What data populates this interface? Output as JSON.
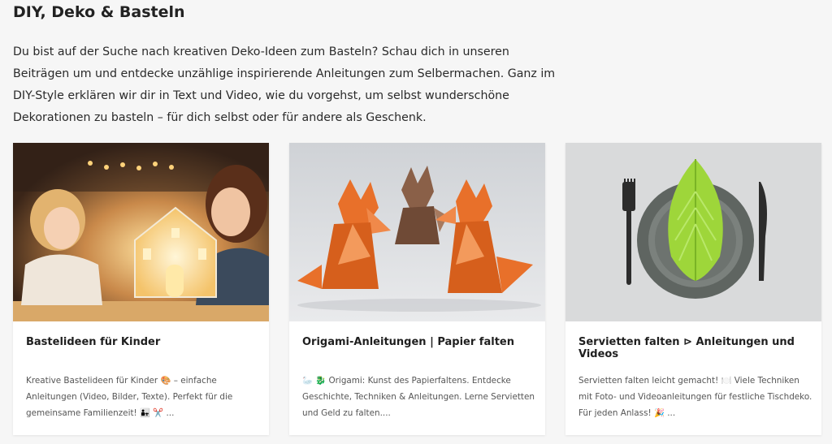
{
  "heading": "DIY, Deko & Basteln",
  "intro": "Du bist auf der Suche nach kreativen Deko-Ideen zum Basteln? Schau dich in unseren Beiträgen um und entdecke unzählige inspirierende Anleitungen zum Selbermachen. Ganz im DIY-Style erklären wir dir in Text und Video, wie du vorgehst, um selbst wunderschöne Dekorationen zu basteln – für dich selbst oder für andere als Geschenk.",
  "cards": [
    {
      "title": "Bastelideen für Kinder",
      "description": "Kreative Bastelideen für Kinder 🎨 – einfache Anleitungen (Video, Bilder, Texte). Perfekt für die gemeinsame Familienzeit! 👨‍👧 ✂️ ..."
    },
    {
      "title": "Origami-Anleitungen | Papier falten",
      "description": "🦢 🐉 Origami: Kunst des Papierfaltens. Entdecke Geschichte, Techniken & Anleitungen. Lerne Servietten und Geld zu falten...."
    },
    {
      "title": "Servietten falten ⊳ Anleitungen und Videos",
      "description": "Servietten falten leicht gemacht! 🍽️ Viele Techniken mit Foto- und Videoanleitungen für festliche Tischdeko. Für jeden Anlass! 🎉 ..."
    }
  ],
  "colors": {
    "background": "#f6f6f6",
    "card": "#ffffff",
    "fox_orange": "#e8702a",
    "fox_brown": "#8a6048",
    "napkin_green": "#9ed63a"
  }
}
